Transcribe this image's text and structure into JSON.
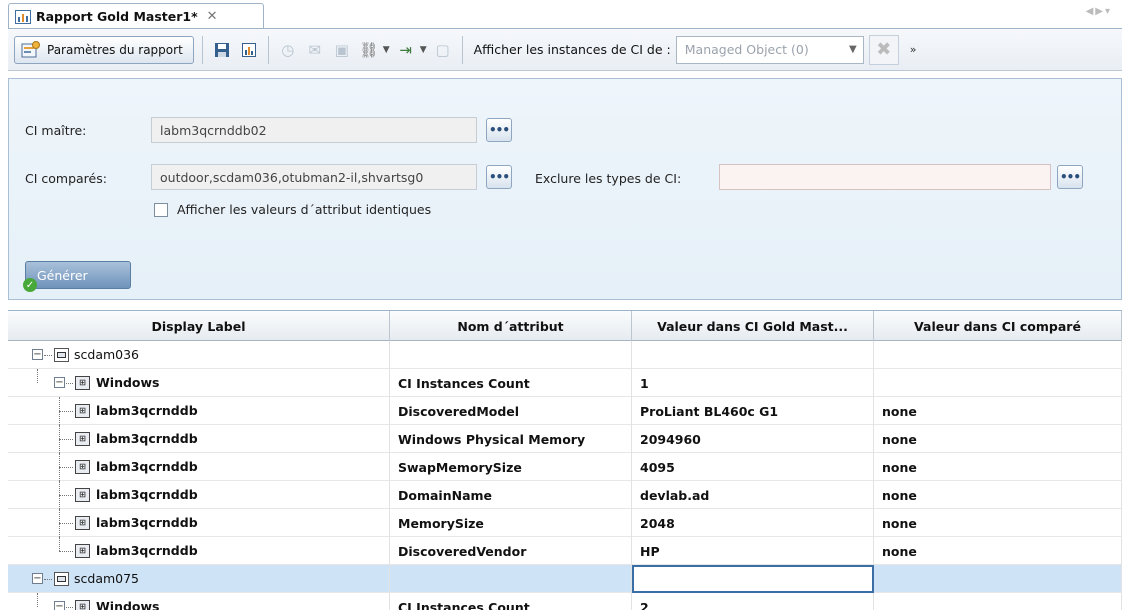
{
  "tab": {
    "title": "Rapport Gold Master1*"
  },
  "toolbar": {
    "params_label": "Paramètres du rapport",
    "instances_label": "Afficher les instances de CI de :",
    "instances_select": "Managed Object (0)"
  },
  "form": {
    "master_label": "CI maître:",
    "master_value": "labm3qcrnddb02",
    "compared_label": "CI comparés:",
    "compared_value": "outdoor,scdam036,otubman2-il,shvartsg0",
    "exclude_label": "Exclure les types de CI:",
    "exclude_value": "",
    "show_identical_label": "Afficher les valeurs d´attribut identiques",
    "show_identical_checked": false,
    "generate_label": "Générer"
  },
  "table": {
    "headers": [
      "Display Label",
      "Nom d´attribut",
      "Valeur dans CI Gold Mast...",
      "Valeur dans CI comparé"
    ],
    "rows": [
      {
        "label": "scdam036",
        "attr": "",
        "gold": "",
        "compared": ""
      },
      {
        "label": "Windows",
        "attr": "CI Instances Count",
        "gold": "1",
        "compared": ""
      },
      {
        "label": "labm3qcrnddb",
        "attr": "DiscoveredModel",
        "gold": "ProLiant BL460c G1",
        "compared": "none"
      },
      {
        "label": "labm3qcrnddb",
        "attr": "Windows Physical Memory",
        "gold": "2094960",
        "compared": "none"
      },
      {
        "label": "labm3qcrnddb",
        "attr": "SwapMemorySize",
        "gold": "4095",
        "compared": "none"
      },
      {
        "label": "labm3qcrnddb",
        "attr": "DomainName",
        "gold": "devlab.ad",
        "compared": "none"
      },
      {
        "label": "labm3qcrnddb",
        "attr": "MemorySize",
        "gold": "2048",
        "compared": "none"
      },
      {
        "label": "labm3qcrnddb",
        "attr": "DiscoveredVendor",
        "gold": "HP",
        "compared": "none"
      },
      {
        "label": "scdam075",
        "attr": "",
        "gold": "",
        "compared": ""
      },
      {
        "label": "Windows",
        "attr": "CI Instances Count",
        "gold": "2",
        "compared": ""
      }
    ]
  },
  "colors": {
    "panel_bg": "#e6f0f8",
    "selected_row": "#cfe3f7",
    "generate_button": "#6f93bb"
  }
}
